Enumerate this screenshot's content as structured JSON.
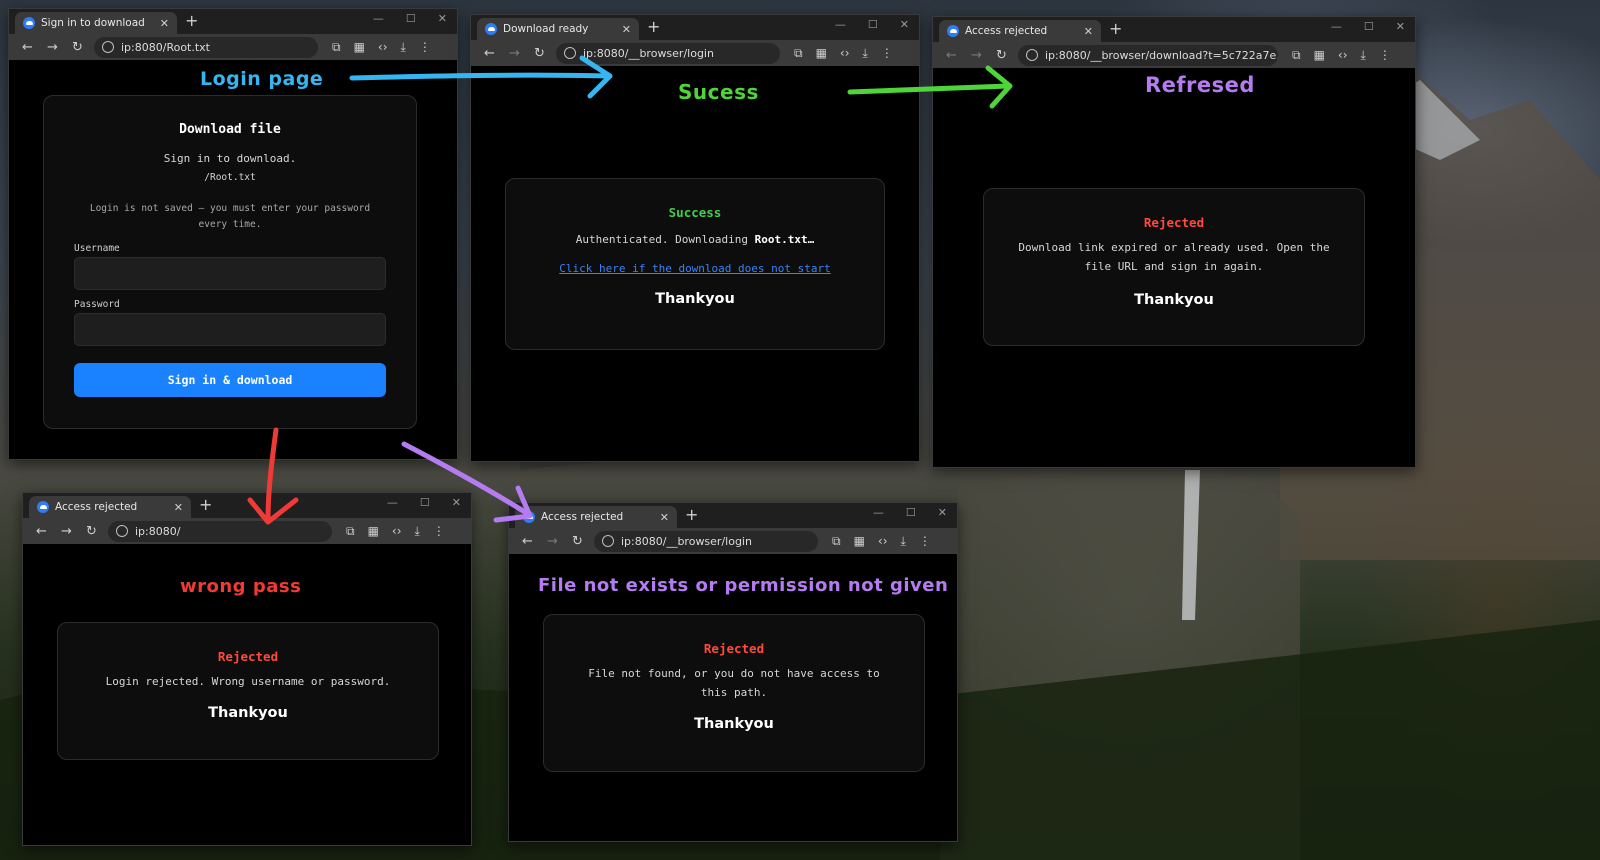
{
  "windows": {
    "login": {
      "tab_title": "Sign in to download",
      "url": "ip:8080/Root.txt",
      "annotation": "Login page",
      "card_title": "Download file",
      "subtitle": "Sign in to download.",
      "path": "/Root.txt",
      "notice": "Login is not saved — you must enter your password every time.",
      "username_label": "Username",
      "password_label": "Password",
      "button_label": "Sign in & download"
    },
    "success": {
      "tab_title": "Download ready",
      "url": "ip:8080/__browser/login",
      "annotation": "Sucess",
      "status": "Success",
      "message_prefix": "Authenticated. Downloading ",
      "message_file": "Root.txt…",
      "link_text": "Click here if the download does not start",
      "thanks": "Thankyou"
    },
    "refreshed": {
      "tab_title": "Access rejected",
      "url": "ip:8080/__browser/download?t=5c722a7e...",
      "annotation": "Refresed",
      "status": "Rejected",
      "message": "Download link expired or already used. Open the file URL and sign in again.",
      "thanks": "Thankyou"
    },
    "wrong_pass": {
      "tab_title": "Access rejected",
      "url": "ip:8080/",
      "annotation": "wrong pass",
      "status": "Rejected",
      "message": "Login rejected. Wrong username or password.",
      "thanks": "Thankyou"
    },
    "no_file": {
      "tab_title": "Access rejected",
      "url": "ip:8080/__browser/login",
      "annotation": "File not exists or permission not given",
      "status": "Rejected",
      "message": "File not found, or you do not have access to this path.",
      "thanks": "Thankyou"
    }
  },
  "icons": {
    "back": "arrow-left-icon",
    "forward": "arrow-right-icon",
    "reload": "reload-icon",
    "extensions": "puzzle-icon",
    "apps": "grid-icon",
    "devtools": "code-icon",
    "download": "download-icon",
    "menu": "kebab-menu-icon"
  },
  "colors": {
    "annotation_blue": "#35b6f0",
    "annotation_green": "#4fd43a",
    "annotation_purple": "#b57cf2",
    "annotation_red": "#ef3a35",
    "success_green": "#3fcf4a",
    "rejected_red": "#ff4a3d",
    "button_blue": "#1a82ff",
    "link_blue": "#3b82f6"
  }
}
